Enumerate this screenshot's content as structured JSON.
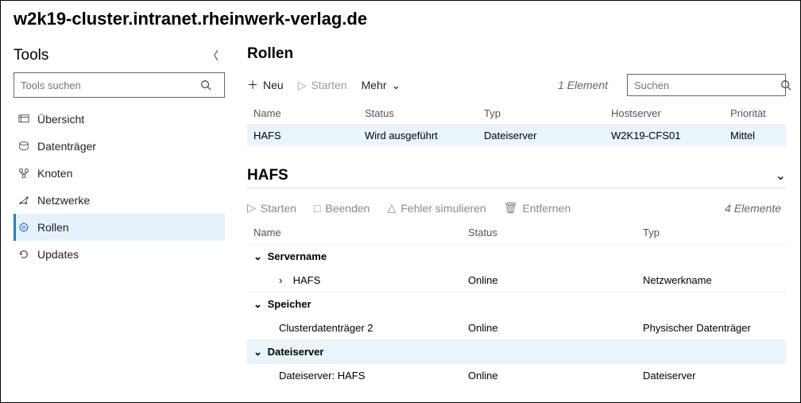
{
  "header": {
    "title": "w2k19-cluster.intranet.rheinwerk-verlag.de"
  },
  "tools": {
    "heading": "Tools",
    "search_placeholder": "Tools suchen",
    "items": [
      {
        "label": "Übersicht"
      },
      {
        "label": "Datenträger"
      },
      {
        "label": "Knoten"
      },
      {
        "label": "Netzwerke"
      },
      {
        "label": "Rollen"
      },
      {
        "label": "Updates"
      }
    ]
  },
  "roles": {
    "heading": "Rollen",
    "actions": {
      "new": "Neu",
      "start": "Starten",
      "more": "Mehr"
    },
    "count_label": "1 Element",
    "search_placeholder": "Suchen",
    "columns": {
      "name": "Name",
      "status": "Status",
      "type": "Typ",
      "host": "Hostserver",
      "priority": "Priorität"
    },
    "rows": [
      {
        "name": "HAFS",
        "status": "Wird ausgeführt",
        "type": "Dateiserver",
        "host": "W2K19-CFS01",
        "priority": "Mittel"
      }
    ]
  },
  "detail": {
    "heading": "HAFS",
    "actions": {
      "start": "Starten",
      "stop": "Beenden",
      "simfail": "Fehler simulieren",
      "remove": "Entfernen"
    },
    "count_label": "4 Elemente",
    "columns": {
      "name": "Name",
      "status": "Status",
      "type": "Typ"
    },
    "groups": [
      {
        "label": "Servername",
        "rows": [
          {
            "name": "HAFS",
            "status": "Online",
            "type": "Netzwerkname",
            "expandable": true
          }
        ]
      },
      {
        "label": "Speicher",
        "rows": [
          {
            "name": "Clusterdatenträger 2",
            "status": "Online",
            "type": "Physischer Datenträger",
            "expandable": false
          }
        ]
      },
      {
        "label": "Dateiserver",
        "selected": true,
        "rows": [
          {
            "name": "Dateiserver: HAFS",
            "status": "Online",
            "type": "Dateiserver",
            "expandable": false
          }
        ]
      }
    ]
  }
}
